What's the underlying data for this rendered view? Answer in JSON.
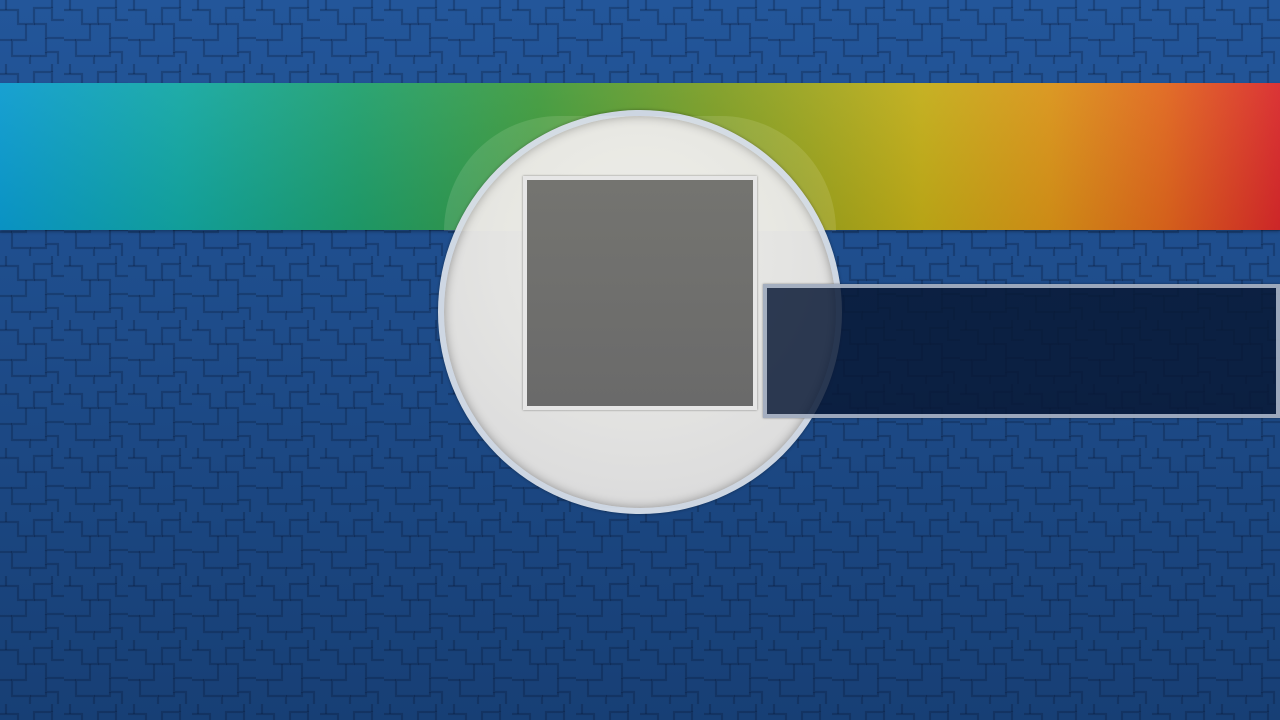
{
  "screen": {
    "description_text": "",
    "colors": {
      "background_top": "#23569a",
      "background_bottom": "#173f75",
      "spectrum_start": "#0a9bcf",
      "spectrum_end": "#d9282a",
      "disc_face": "#e4e4e2",
      "square_fill": "#6e6e6e",
      "wide_fill": "#08183b"
    }
  },
  "elements": {
    "background": {
      "icon": "tile-texture"
    },
    "band": {
      "icon": "spectrum-gradient-bar"
    },
    "disc": {
      "icon": "circle-disc"
    },
    "square": {
      "icon": "square-outline"
    },
    "wide": {
      "icon": "rectangle-outline"
    }
  }
}
